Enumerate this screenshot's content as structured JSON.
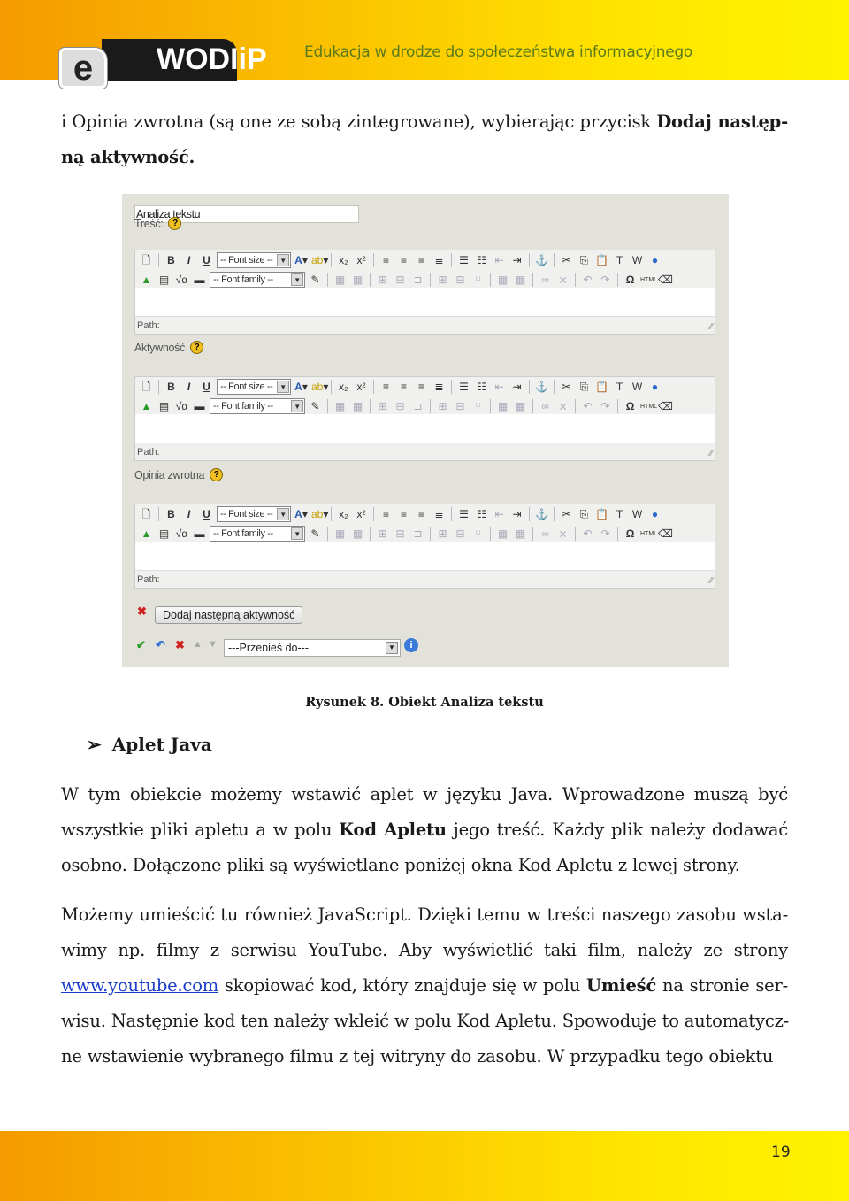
{
  "header": {
    "logo_e": "e",
    "logo_text": "WODIiP",
    "tagline": "Edukacja w drodze do społeczeństwa informacyjnego"
  },
  "intro": [
    [
      {
        "t": "i Opinia zwrotna (są one ze sobą zintegrowane), wybierając przycisk "
      },
      {
        "t": "Dodaj następ-",
        "b": true
      }
    ],
    [
      {
        "t": "ną aktywność.",
        "b": true
      }
    ]
  ],
  "screenshot": {
    "title_value": "Analiza tekstu",
    "fields": [
      {
        "label": "Treść:",
        "help": "?"
      },
      {
        "label": "Aktywność",
        "help": "?"
      },
      {
        "label": "Opinia zwrotna",
        "help": "?"
      }
    ],
    "font_size_label": "-- Font size --",
    "font_family_label": "-- Font family --",
    "path_label": "Path:",
    "add_button": "Dodaj następną aktywność",
    "move_select": "---Przenieś do---",
    "html_label": "HTML"
  },
  "caption": "Rysunek 8. Obiekt Analiza tekstu",
  "section_heading": "Aplet Java",
  "paragraph1": [
    [
      {
        "t": "W tym obiekcie możemy wstawić aplet w języku Java. Wprowadzone muszą być"
      }
    ],
    [
      {
        "t": "wszystkie pliki apletu a w polu "
      },
      {
        "t": "Kod Apletu",
        "b": true
      },
      {
        "t": " jego treść. Każdy plik należy dodawać"
      }
    ],
    [
      {
        "t": "osobno. Dołączone pliki są wyświetlane poniżej okna Kod Apletu z lewej strony."
      }
    ]
  ],
  "paragraph2": [
    [
      {
        "t": "Możemy umieścić tu również JavaScript. Dzięki temu w treści naszego zasobu wsta-"
      }
    ],
    [
      {
        "t": "wimy np. filmy z serwisu YouTube. Aby wyświetlić taki film, należy ze strony"
      }
    ],
    [
      {
        "t": "www.youtube.com",
        "link": true
      },
      {
        "t": " skopiować kod, który znajduje się w polu "
      },
      {
        "t": "Umieść",
        "b": true
      },
      {
        "t": " na stronie ser-"
      }
    ],
    [
      {
        "t": "wisu. Następnie kod ten należy wkleić w polu Kod Apletu. Spowoduje to automatycz-"
      }
    ],
    [
      {
        "t": "ne wstawienie wybranego filmu z tej witryny do zasobu. W przypadku tego obiektu"
      }
    ]
  ],
  "page_number": "19",
  "colors": {
    "band_start": "#f59a00",
    "band_end": "#fff200",
    "tagline": "#5a7a1a",
    "link": "#1a3cc8",
    "panel": "#e2e1da"
  }
}
